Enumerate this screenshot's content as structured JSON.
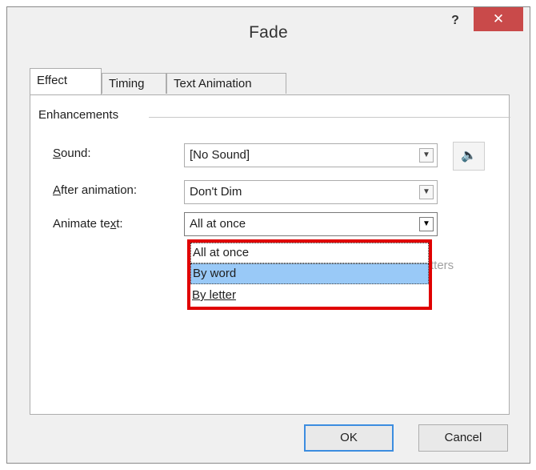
{
  "dialog": {
    "title": "Fade",
    "help_label": "?",
    "close_label": "✕"
  },
  "tabs": [
    {
      "label": "Effect",
      "active": true
    },
    {
      "label": "Timing",
      "active": false
    },
    {
      "label": "Text Animation",
      "active": false
    }
  ],
  "enhancements": {
    "group_label": "Enhancements",
    "sound": {
      "label_pre": "",
      "label_access": "S",
      "label_post": "ound:",
      "value": "[No Sound]"
    },
    "after_animation": {
      "label_pre": "",
      "label_access": "A",
      "label_post": "fter animation:",
      "value": "Don't Dim"
    },
    "animate_text": {
      "label_pre": "Animate te",
      "label_access": "x",
      "label_post": "t:",
      "value": "All at once"
    },
    "obscured_text": "tters"
  },
  "dropdown": {
    "options": [
      "All at once",
      "By word",
      "By letter"
    ],
    "highlighted": "By word",
    "annotation_color": "#e00000"
  },
  "buttons": {
    "ok": "OK",
    "cancel": "Cancel"
  },
  "icons": {
    "sound": "speaker-icon",
    "dropdown": "chevron-down-icon",
    "close": "close-icon"
  },
  "colors": {
    "close_bg": "#c94a4a",
    "selection_bg": "#99c9f7",
    "default_button_border": "#3c8de0"
  }
}
